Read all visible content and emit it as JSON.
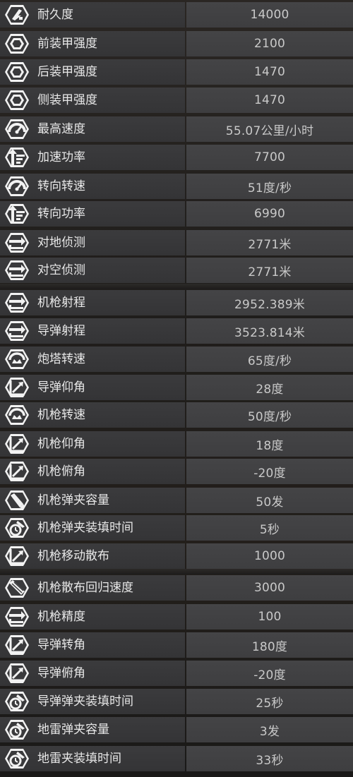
{
  "stats": [
    {
      "label": "耐久度",
      "value": "14000",
      "icon": "durability-icon"
    },
    {
      "label": "前装甲强度",
      "value": "2100",
      "icon": "armor-icon"
    },
    {
      "label": "后装甲强度",
      "value": "1470",
      "icon": "armor-icon"
    },
    {
      "label": "侧装甲强度",
      "value": "1470",
      "icon": "armor-icon"
    },
    {
      "label": "最高速度",
      "value": "55.07公里/小时",
      "icon": "speedometer-icon"
    },
    {
      "label": "加速功率",
      "value": "7700",
      "icon": "acceleration-icon"
    },
    {
      "label": "转向转速",
      "value": "51度/秒",
      "icon": "speedometer-icon"
    },
    {
      "label": "转向功率",
      "value": "6990",
      "icon": "acceleration-icon"
    },
    {
      "label": "对地侦测",
      "value": "2771米",
      "icon": "range-icon"
    },
    {
      "label": "对空侦测",
      "value": "2771米",
      "icon": "range-icon"
    },
    {
      "label": "机枪射程",
      "value": "2952.389米",
      "icon": "range-icon"
    },
    {
      "label": "导弹射程",
      "value": "3523.814米",
      "icon": "range-icon"
    },
    {
      "label": "炮塔转速",
      "value": "65度/秒",
      "icon": "turret-rotation-icon"
    },
    {
      "label": "导弹仰角",
      "value": "28度",
      "icon": "elevation-icon"
    },
    {
      "label": "机枪转速",
      "value": "50度/秒",
      "icon": "turret-rotation-icon"
    },
    {
      "label": "机枪仰角",
      "value": "18度",
      "icon": "elevation-icon"
    },
    {
      "label": "机枪俯角",
      "value": "-20度",
      "icon": "elevation-icon"
    },
    {
      "label": "机枪弹夹容量",
      "value": "50发",
      "icon": "ammo-icon"
    },
    {
      "label": "机枪弹夹装填时间",
      "value": "5秒",
      "icon": "reload-timer-icon"
    },
    {
      "label": "机枪移动散布",
      "value": "1000",
      "icon": "elevation-icon"
    },
    {
      "label": "机枪散布回归速度",
      "value": "3000",
      "icon": "ammo-belt-icon"
    },
    {
      "label": "机枪精度",
      "value": "100",
      "icon": "range-icon"
    },
    {
      "label": "导弹转角",
      "value": "180度",
      "icon": "elevation-icon"
    },
    {
      "label": "导弹俯角",
      "value": "-20度",
      "icon": "elevation-icon"
    },
    {
      "label": "导弹弹夹装填时间",
      "value": "25秒",
      "icon": "reload-timer-icon"
    },
    {
      "label": "地雷弹夹容量",
      "value": "3发",
      "icon": "reload-timer-icon"
    },
    {
      "label": "地雷夹装填时间",
      "value": "33秒",
      "icon": "reload-timer-icon"
    }
  ]
}
